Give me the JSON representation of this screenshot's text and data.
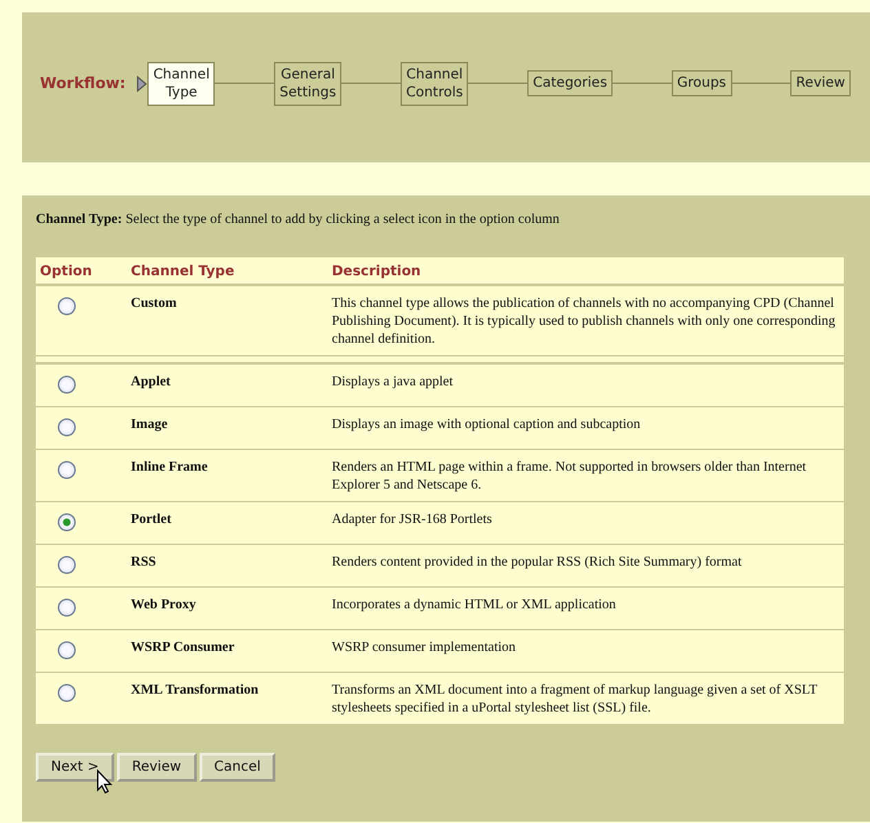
{
  "workflow": {
    "label": "Workflow:",
    "steps": [
      {
        "label": "Channel Type",
        "selected": true
      },
      {
        "label": "General Settings",
        "selected": false
      },
      {
        "label": "Channel Controls",
        "selected": false
      },
      {
        "label": "Categories",
        "selected": false
      },
      {
        "label": "Groups",
        "selected": false
      },
      {
        "label": "Review",
        "selected": false
      }
    ]
  },
  "instruction": {
    "label": "Channel Type:",
    "text": "Select the type of channel to add by clicking a select icon in the option column"
  },
  "table": {
    "columns": [
      "Option",
      "Channel Type",
      "Description"
    ],
    "groups": [
      {
        "rows": [
          {
            "type": "Custom",
            "description": "This channel type allows the publication of channels with no accompanying CPD (Channel Publishing Document). It is typically used to publish channels with only one corresponding channel definition.",
            "selected": false
          }
        ]
      },
      {
        "rows": [
          {
            "type": "Applet",
            "description": "Displays a java applet",
            "selected": false
          },
          {
            "type": "Image",
            "description": "Displays an image with optional caption and subcaption",
            "selected": false
          },
          {
            "type": "Inline Frame",
            "description": "Renders an HTML page within a frame. Not supported in browsers older than Internet Explorer 5 and Netscape 6.",
            "selected": false
          },
          {
            "type": "Portlet",
            "description": "Adapter for JSR-168 Portlets",
            "selected": true
          },
          {
            "type": "RSS",
            "description": "Renders content provided in the popular RSS (Rich Site Summary) format",
            "selected": false
          },
          {
            "type": "Web Proxy",
            "description": "Incorporates a dynamic HTML or XML application",
            "selected": false
          },
          {
            "type": "WSRP Consumer",
            "description": "WSRP consumer implementation",
            "selected": false
          },
          {
            "type": "XML Transformation",
            "description": "Transforms an XML document into a fragment of markup language given a set of XSLT stylesheets specified in a uPortal stylesheet list (SSL) file.",
            "selected": false
          }
        ]
      }
    ]
  },
  "buttons": [
    "Next >",
    "Review",
    "Cancel"
  ]
}
